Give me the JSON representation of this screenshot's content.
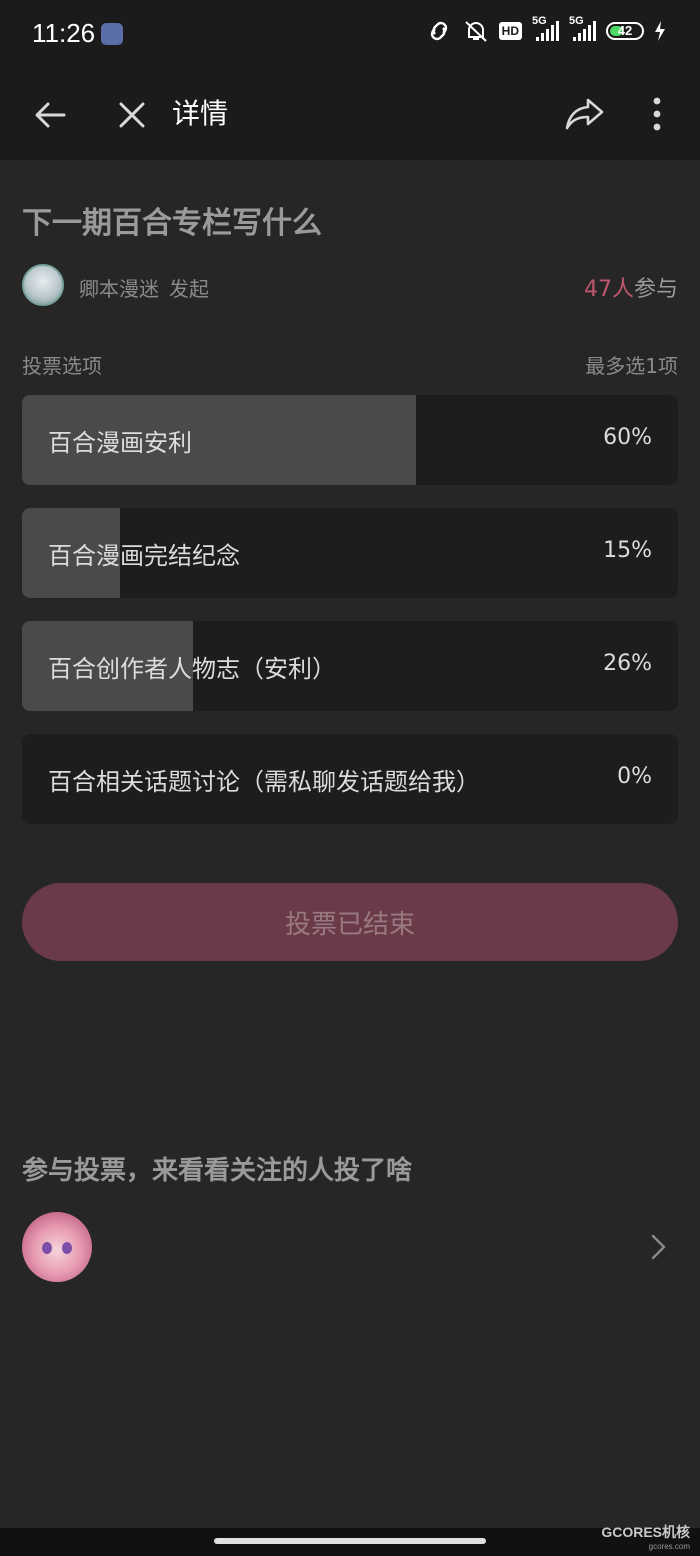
{
  "status_bar": {
    "time": "11:26",
    "hd_label": "HD",
    "signal1_label": "5G",
    "signal2_label": "5G",
    "battery": "42"
  },
  "app_bar": {
    "title": "详情"
  },
  "poll": {
    "title": "下一期百合专栏写什么",
    "author": "卿本漫迷",
    "author_action": "发起",
    "participant_count": "47人",
    "participant_suffix": "参与",
    "options_label": "投票选项",
    "selection_limit": "最多选1项",
    "options": [
      {
        "label": "百合漫画安利",
        "percent": "60%",
        "fill": 0.6
      },
      {
        "label": "百合漫画完结纪念",
        "percent": "15%",
        "fill": 0.15
      },
      {
        "label": "百合创作者人物志（安利）",
        "percent": "26%",
        "fill": 0.26
      },
      {
        "label": "百合相关话题讨论（需私聊发话题给我）",
        "percent": "0%",
        "fill": 0.0
      }
    ],
    "ended_button": "投票已结束"
  },
  "friends": {
    "title": "参与投票，来看看关注的人投了啥"
  },
  "watermark": {
    "brand": "GCORES机核",
    "domain": "gcores.com"
  },
  "colors": {
    "accent": "#c0576e",
    "button_bg": "#6b3a48"
  }
}
